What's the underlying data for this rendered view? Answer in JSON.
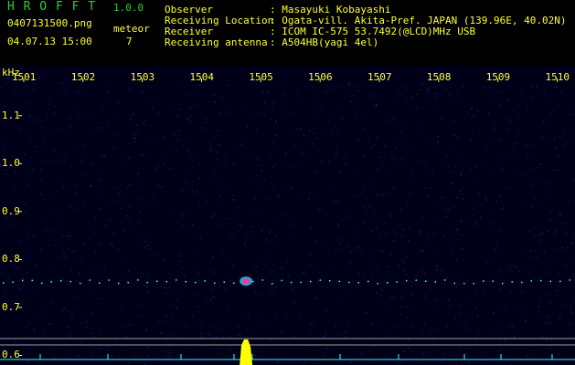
{
  "app": {
    "name": "H R O F F T",
    "version": "1.0.0"
  },
  "file": {
    "name": "0407131500.png",
    "datetime": "04.07.13 15:00"
  },
  "meteor": {
    "label": "meteor",
    "count": "7"
  },
  "info": [
    {
      "label": "Observer",
      "value": ": Masayuki Kobayashi"
    },
    {
      "label": "Receiving Location",
      "value": ": Ogata-vill. Akita-Pref. JAPAN (139.96E, 40.02N)"
    },
    {
      "label": "Receiver",
      "value": ": ICOM IC-575 53.7492(@LCD)MHz USB"
    },
    {
      "label": "Receiving antenna",
      "value": ": A504HB(yagi 4el)"
    }
  ],
  "chart_data": {
    "type": "heatmap",
    "ylabel": "kHz",
    "x_ticks": [
      "1501",
      "1502",
      "1503",
      "1504",
      "1505",
      "1506",
      "1507",
      "1508",
      "1509",
      "1510"
    ],
    "y_ticks": [
      "1.1",
      "1.0",
      "0.9",
      "0.8",
      "0.7",
      "0.6"
    ],
    "ylim": [
      0.58,
      1.17
    ],
    "xlim": [
      1500.6,
      1510.3
    ],
    "meteor_echo": {
      "x": 1504.75,
      "y": 0.755
    },
    "carrier_line_y": 0.755,
    "colors": {
      "background": "#000018",
      "noise": "#1a1a70",
      "echo": "#ff3399",
      "echo_halo": "#33ccff",
      "peak": "#ffff00",
      "trace": "#33ffff"
    }
  }
}
